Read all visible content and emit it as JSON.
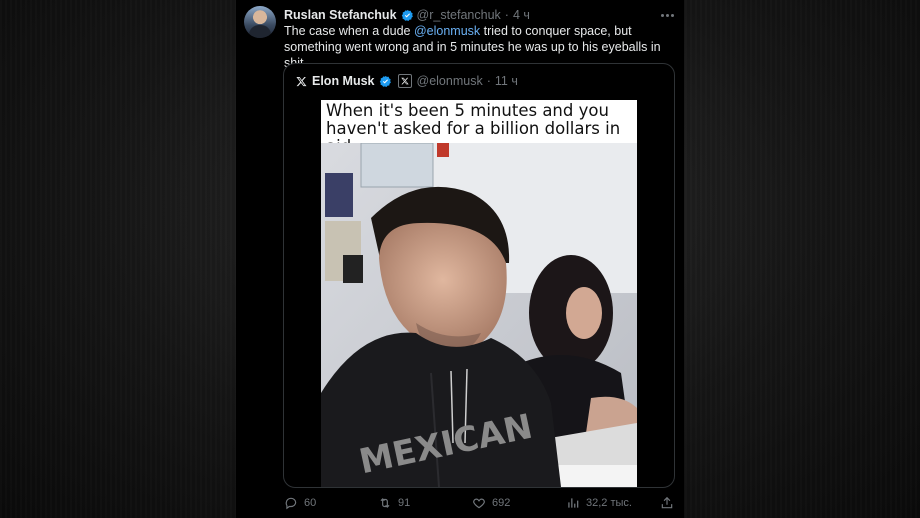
{
  "tweet": {
    "author_name": "Ruslan Stefanchuk",
    "author_handle": "@r_stefanchuk",
    "separator": "·",
    "time": "4 ч",
    "text_before": "The case when a dude ",
    "mention": "@elonmusk",
    "text_after": " tried to conquer space, but something went wrong and in 5 minutes he was up to his eyeballs in shit."
  },
  "quote": {
    "author_name": "Elon Musk",
    "author_handle": "@elonmusk",
    "separator": "·",
    "time": "11 ч",
    "meme_caption": "When it's been 5 minutes and you haven't asked for a billion dollars in aid:"
  },
  "actions": {
    "replies": "60",
    "reposts": "91",
    "likes": "692",
    "views": "32,2 тыс."
  },
  "colors": {
    "accent": "#1d9bf0",
    "mention": "#6ab0f3",
    "muted": "#71767b"
  },
  "icons": [
    "verified-badge-icon",
    "more-icon",
    "x-logo-icon",
    "reply-icon",
    "repost-icon",
    "like-icon",
    "views-icon",
    "share-icon"
  ]
}
